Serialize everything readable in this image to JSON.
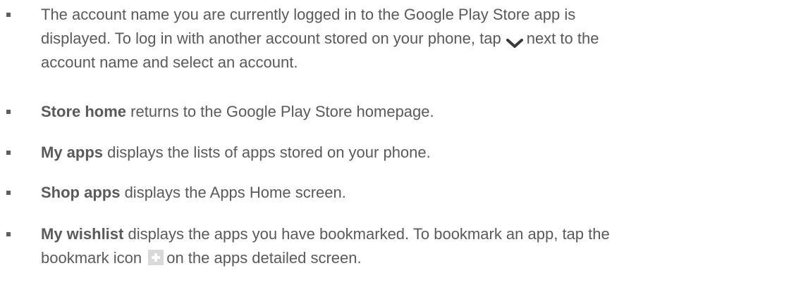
{
  "items": [
    {
      "line1": "The account name you are currently logged in to the Google Play Store app is",
      "line2a": "displayed. To log in with another account stored on your phone, tap",
      "line2b": "next to the",
      "line3": "account name and select an account.",
      "icon": "chevron-down-icon"
    },
    {
      "bold": "Store home",
      "rest": " returns to the Google Play Store homepage."
    },
    {
      "bold": "My apps",
      "rest": " displays the lists of apps stored on your phone."
    },
    {
      "bold": "Shop apps",
      "rest": " displays the Apps Home screen."
    },
    {
      "bold": "My wishlist",
      "line1_rest": " displays the apps you have bookmarked. To bookmark an app, tap the",
      "line2a": "bookmark icon",
      "line2b": "on the apps detailed screen.",
      "icon": "bookmark-plus-icon"
    }
  ]
}
